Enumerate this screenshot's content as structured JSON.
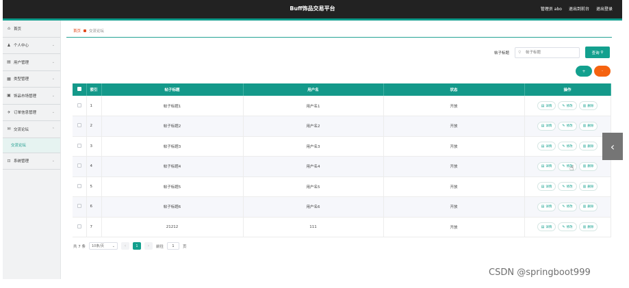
{
  "app": {
    "title": "Buff饰品交易平台",
    "user_label": "管理员 abo",
    "link_front": "退出到前台",
    "link_logout": "退出登录"
  },
  "sidebar": {
    "items": [
      {
        "label": "首页",
        "icon": "home-icon",
        "glyph": "⌂"
      },
      {
        "label": "个人中心",
        "icon": "user-icon",
        "glyph": "♟"
      },
      {
        "label": "用户管理",
        "icon": "users-icon",
        "glyph": "▤"
      },
      {
        "label": "类型管理",
        "icon": "grid-icon",
        "glyph": "▦"
      },
      {
        "label": "饰品市场管理",
        "icon": "market-icon",
        "glyph": "▣"
      },
      {
        "label": "订单信息管理",
        "icon": "send-icon",
        "glyph": "✈"
      },
      {
        "label": "交流论坛",
        "icon": "mail-icon",
        "glyph": "✉"
      },
      {
        "label": "系统管理",
        "icon": "crop-icon",
        "glyph": "⊡"
      }
    ],
    "sub_item": "交流论坛"
  },
  "breadcrumb": {
    "home": "首页",
    "current": "交流论坛"
  },
  "search": {
    "label": "帖子标题",
    "placeholder": "帖子标题",
    "button": "查询"
  },
  "actions": {
    "add": "+",
    "delete": "-"
  },
  "table": {
    "headers": [
      "索引",
      "帖子标题",
      "用户名",
      "状态",
      "操作"
    ],
    "op_labels": {
      "detail": "详情",
      "edit": "修改",
      "delete": "删除"
    },
    "rows": [
      {
        "index": "1",
        "title": "帖子标题1",
        "user": "用户名1",
        "status": "开放"
      },
      {
        "index": "2",
        "title": "帖子标题2",
        "user": "用户名2",
        "status": "开放"
      },
      {
        "index": "3",
        "title": "帖子标题3",
        "user": "用户名3",
        "status": "开放"
      },
      {
        "index": "4",
        "title": "帖子标题4",
        "user": "用户名4",
        "status": "开放"
      },
      {
        "index": "5",
        "title": "帖子标题5",
        "user": "用户名5",
        "status": "开放"
      },
      {
        "index": "6",
        "title": "帖子标题6",
        "user": "用户名6",
        "status": "开放"
      },
      {
        "index": "7",
        "title": "21212",
        "user": "111",
        "status": "开放"
      }
    ]
  },
  "pagination": {
    "total": "共 7 条",
    "page_size": "10条/页",
    "current": "1",
    "goto_prefix": "前往",
    "goto_value": "1",
    "goto_suffix": "页"
  },
  "watermark": "CSDN @springboot999",
  "colors": {
    "accent": "#13a08e",
    "danger": "#f56310",
    "topbar": "#222222"
  }
}
